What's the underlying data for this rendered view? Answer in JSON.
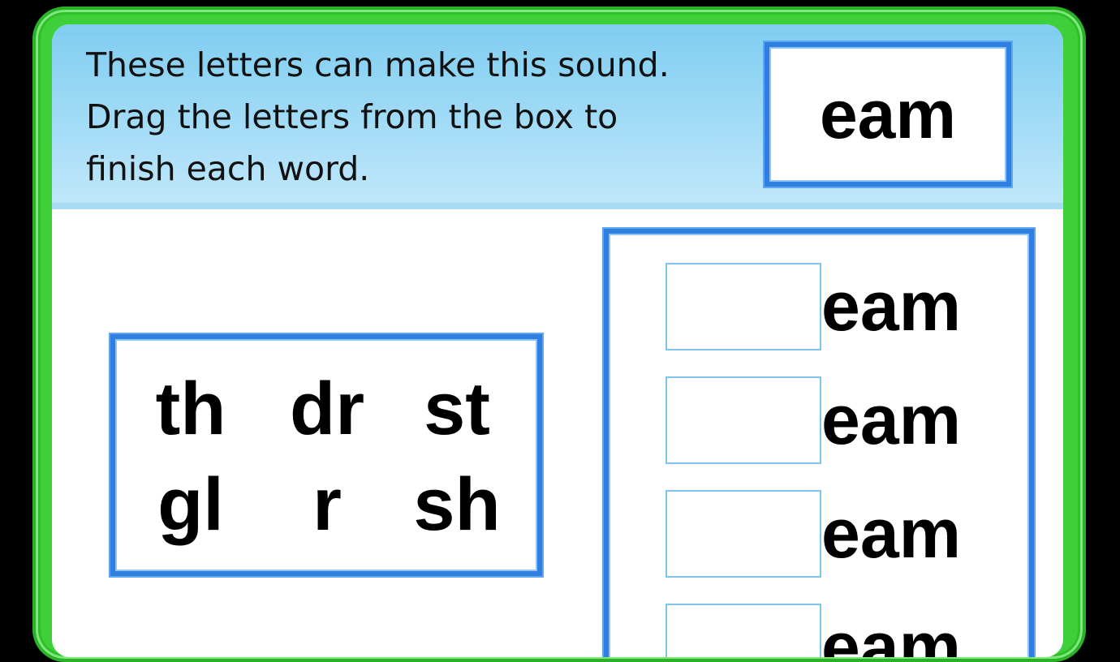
{
  "colors": {
    "frame_green": "#3fcf3a",
    "header_blue": "#7fcdf1",
    "box_border_blue": "#2f7fe0",
    "slot_border": "#7ec4ef",
    "background": "#000000"
  },
  "header": {
    "instructions": [
      "These letters can make this sound.",
      "Drag the letters from the box to",
      "finish each word."
    ],
    "sound": "eam"
  },
  "letter_bank": {
    "tiles": [
      "th",
      "dr",
      "st",
      "gl",
      "r",
      "sh"
    ]
  },
  "words": [
    {
      "filled": "",
      "ending": "eam"
    },
    {
      "filled": "",
      "ending": "eam"
    },
    {
      "filled": "",
      "ending": "eam"
    },
    {
      "filled": "",
      "ending": "eam"
    }
  ]
}
